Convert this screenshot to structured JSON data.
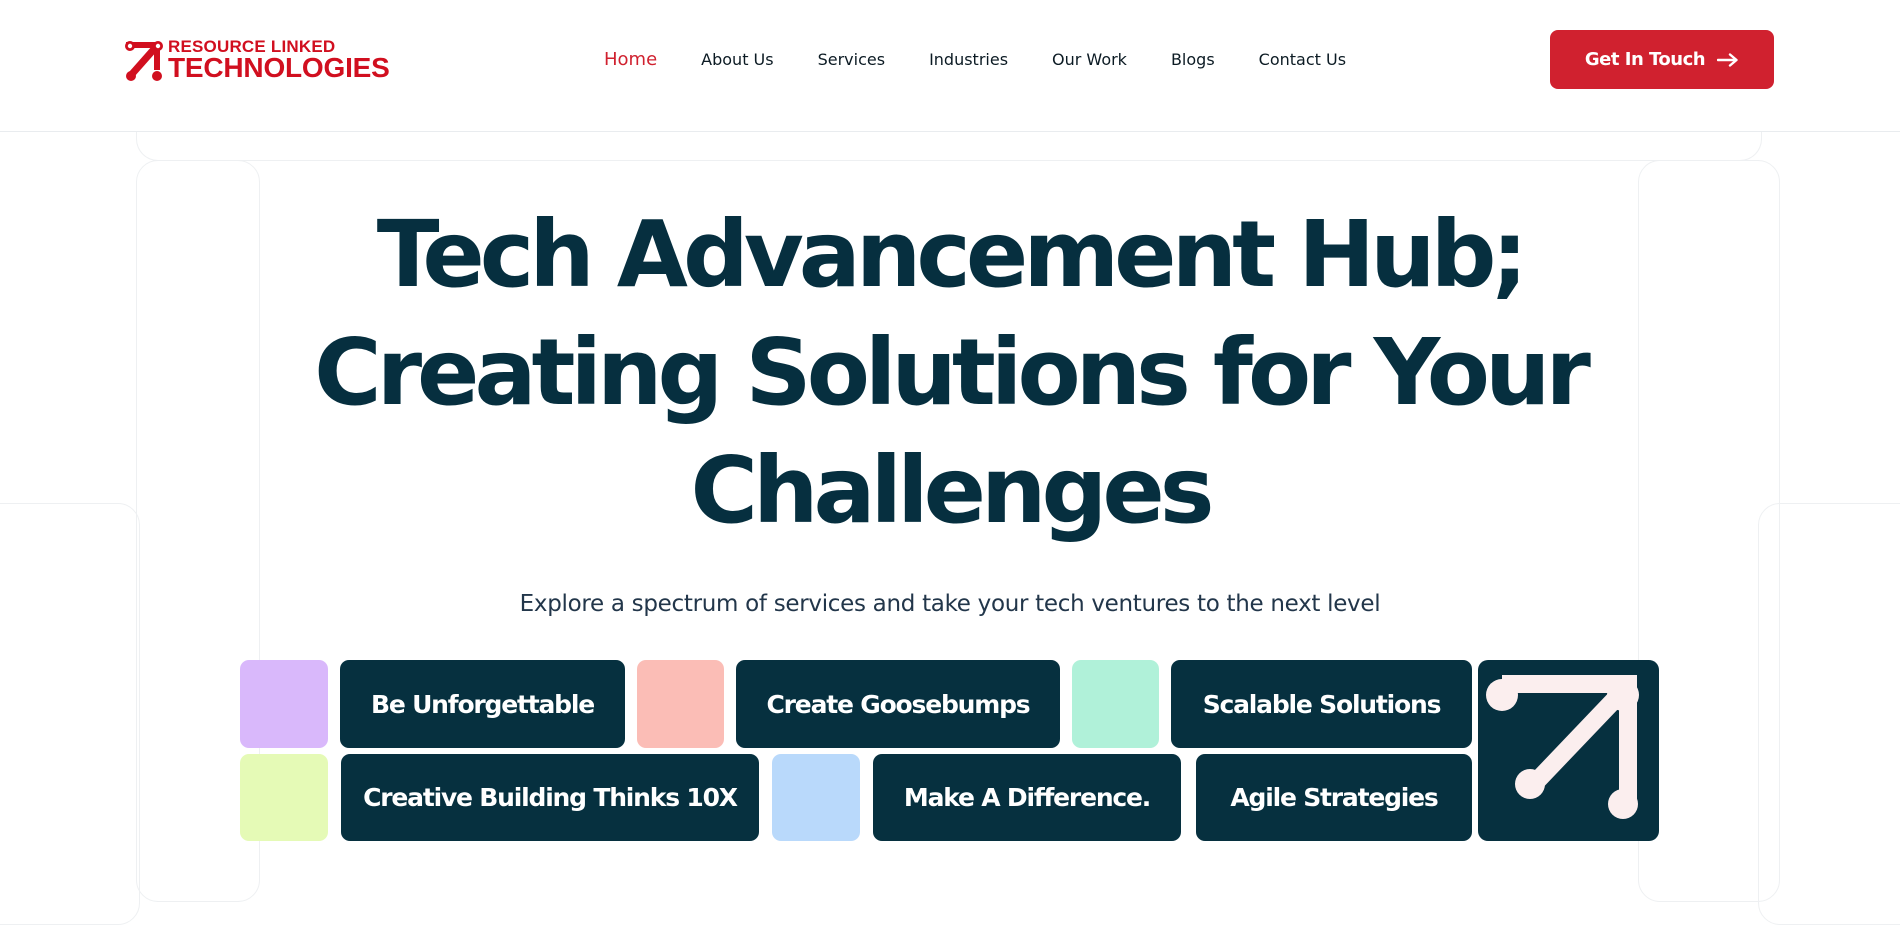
{
  "header": {
    "logo": {
      "line1": "RESOURCE LINKED",
      "line2": "TECHNOLOGIES",
      "mark_icon": "arrow-up-right-icon",
      "brand_color": "#d10f1f"
    },
    "nav": [
      {
        "label": "Home",
        "active": true
      },
      {
        "label": "About Us"
      },
      {
        "label": "Services"
      },
      {
        "label": "Industries"
      },
      {
        "label": "Our Work"
      },
      {
        "label": "Blogs"
      },
      {
        "label": "Contact Us"
      }
    ],
    "cta": {
      "label": "Get In Touch",
      "icon": "arrow-right-icon",
      "color": "#d0212f"
    }
  },
  "hero": {
    "title_lines": [
      "Tech Advancement Hub;",
      "Creating Solutions for Your",
      "Challenges"
    ],
    "subtitle": "Explore a spectrum of services and take your tech ventures to the next level",
    "text_color": "#062f3f"
  },
  "tags": {
    "row1": [
      "Be Unforgettable",
      "Create Goosebumps",
      "Scalable Solutions"
    ],
    "row2": [
      "Creative Building Thinks 10X",
      "Make A Difference.",
      "Agile Strategies"
    ],
    "pill_color": "#06303f",
    "swatches": [
      "#d9b8fb",
      "#fbbdb6",
      "#b0f1d9",
      "#e5fab6",
      "#b9d9fb"
    ],
    "arrow_icon": "arrow-up-right-icon"
  }
}
